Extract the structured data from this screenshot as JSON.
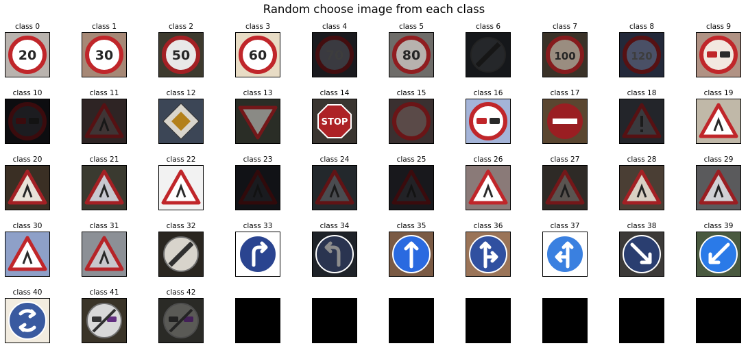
{
  "title": "Random choose image from each class",
  "classes": [
    {
      "label": "class 0",
      "icon": "speed-limit-20-sign-icon",
      "bg": "#b9b3ae",
      "shape": "circle-red",
      "fg": "#ffffff",
      "text": "20",
      "bright": 1.0
    },
    {
      "label": "class 1",
      "icon": "speed-limit-30-sign-icon",
      "bg": "#a68876",
      "shape": "circle-red",
      "fg": "#ffffff",
      "text": "30",
      "bright": 1.0
    },
    {
      "label": "class 2",
      "icon": "speed-limit-50-sign-icon",
      "bg": "#3d3a2e",
      "shape": "circle-red",
      "fg": "#e8e8e8",
      "text": "50",
      "bright": 0.85
    },
    {
      "label": "class 3",
      "icon": "speed-limit-60-sign-icon",
      "bg": "#e8dcc5",
      "shape": "circle-red",
      "fg": "#ffffff",
      "text": "60",
      "bright": 1.0
    },
    {
      "label": "class 4",
      "icon": "speed-limit-70-sign-icon",
      "bg": "#1a1a1e",
      "shape": "circle-red",
      "fg": "#3a3a40",
      "text": "70",
      "bright": 0.35
    },
    {
      "label": "class 5",
      "icon": "speed-limit-80-sign-icon",
      "bg": "#6e6c69",
      "shape": "circle-red",
      "fg": "#b7b2ae",
      "text": "80",
      "bright": 0.75
    },
    {
      "label": "class 6",
      "icon": "end-speed-limit-80-sign-icon",
      "bg": "#15171a",
      "shape": "circle-end",
      "fg": "#25272a",
      "text": "",
      "bright": 0.25
    },
    {
      "label": "class 7",
      "icon": "speed-limit-100-sign-icon",
      "bg": "#3a3228",
      "shape": "circle-red",
      "fg": "#9a8d80",
      "text": "100",
      "bright": 0.7
    },
    {
      "label": "class 8",
      "icon": "speed-limit-120-sign-icon",
      "bg": "#23293a",
      "shape": "circle-red",
      "fg": "#4a5066",
      "text": "120",
      "bright": 0.45
    },
    {
      "label": "class 9",
      "icon": "no-passing-sign-icon",
      "bg": "#b09284",
      "shape": "circle-nopass",
      "fg": "#f2e8e0",
      "text": "",
      "bright": 1.0
    },
    {
      "label": "class 10",
      "icon": "no-passing-trucks-sign-icon",
      "bg": "#0d0d10",
      "shape": "circle-nopass",
      "fg": "#1c1c20",
      "text": "",
      "bright": 0.3
    },
    {
      "label": "class 11",
      "icon": "right-of-way-sign-icon",
      "bg": "#2e2424",
      "shape": "triangle",
      "fg": "#3f3535",
      "text": "",
      "bright": 0.45
    },
    {
      "label": "class 12",
      "icon": "priority-road-sign-icon",
      "bg": "#3c4656",
      "shape": "diamond",
      "fg": "#d9d5cc",
      "text": "",
      "bright": 0.8
    },
    {
      "label": "class 13",
      "icon": "yield-sign-icon",
      "bg": "#2a2d26",
      "shape": "yield",
      "fg": "#8a8a85",
      "text": "",
      "bright": 0.6
    },
    {
      "label": "class 14",
      "icon": "stop-sign-icon",
      "bg": "#3a3530",
      "shape": "octagon",
      "fg": "#ffffff",
      "text": "STOP",
      "bright": 0.9
    },
    {
      "label": "class 15",
      "icon": "no-vehicles-sign-icon",
      "bg": "#3a3030",
      "shape": "circle-plain",
      "fg": "#5a4a48",
      "text": "",
      "bright": 0.55
    },
    {
      "label": "class 16",
      "icon": "no-trucks-sign-icon",
      "bg": "#a4b4d8",
      "shape": "circle-nopass",
      "fg": "#ffffff",
      "text": "",
      "bright": 1.0
    },
    {
      "label": "class 17",
      "icon": "no-entry-sign-icon",
      "bg": "#5a4630",
      "shape": "noentry",
      "fg": "#ffffff",
      "text": "",
      "bright": 0.8
    },
    {
      "label": "class 18",
      "icon": "general-caution-sign-icon",
      "bg": "#23252a",
      "shape": "triangle-excl",
      "fg": "#3a3a3e",
      "text": "",
      "bright": 0.45
    },
    {
      "label": "class 19",
      "icon": "dangerous-curve-left-sign-icon",
      "bg": "#c0b8a8",
      "shape": "triangle",
      "fg": "#ffffff",
      "text": "",
      "bright": 1.0
    },
    {
      "label": "class 20",
      "icon": "dangerous-curve-right-sign-icon",
      "bg": "#3a2f24",
      "shape": "triangle",
      "fg": "#e8e2d8",
      "text": "",
      "bright": 0.85
    },
    {
      "label": "class 21",
      "icon": "double-curve-sign-icon",
      "bg": "#3a3a30",
      "shape": "triangle",
      "fg": "#c8c8d0",
      "text": "",
      "bright": 0.85
    },
    {
      "label": "class 22",
      "icon": "bumpy-road-sign-icon",
      "bg": "#f2f2f2",
      "shape": "triangle",
      "fg": "#ffffff",
      "text": "",
      "bright": 1.0
    },
    {
      "label": "class 23",
      "icon": "slippery-road-sign-icon",
      "bg": "#111216",
      "shape": "triangle",
      "fg": "#1a1b1f",
      "text": "",
      "bright": 0.25
    },
    {
      "label": "class 24",
      "icon": "road-narrows-sign-icon",
      "bg": "#23282c",
      "shape": "triangle",
      "fg": "#4a4c50",
      "text": "",
      "bright": 0.5
    },
    {
      "label": "class 25",
      "icon": "road-work-sign-icon",
      "bg": "#18181c",
      "shape": "triangle",
      "fg": "#222226",
      "text": "",
      "bright": 0.3
    },
    {
      "label": "class 26",
      "icon": "traffic-signals-sign-icon",
      "bg": "#8a7a78",
      "shape": "triangle",
      "fg": "#ffffff",
      "text": "",
      "bright": 1.0
    },
    {
      "label": "class 27",
      "icon": "pedestrians-sign-icon",
      "bg": "#2e2a26",
      "shape": "triangle",
      "fg": "#5a5450",
      "text": "",
      "bright": 0.6
    },
    {
      "label": "class 28",
      "icon": "children-crossing-sign-icon",
      "bg": "#4a3e34",
      "shape": "triangle",
      "fg": "#d8d0c4",
      "text": "",
      "bright": 0.85
    },
    {
      "label": "class 29",
      "icon": "bicycles-crossing-sign-icon",
      "bg": "#5a5a5c",
      "shape": "triangle",
      "fg": "#d0d0d4",
      "text": "",
      "bright": 0.8
    },
    {
      "label": "class 30",
      "icon": "beware-ice-snow-sign-icon",
      "bg": "#8ea0c8",
      "shape": "triangle",
      "fg": "#ffffff",
      "text": "",
      "bright": 1.0
    },
    {
      "label": "class 31",
      "icon": "wild-animals-crossing-sign-icon",
      "bg": "#8c9096",
      "shape": "triangle",
      "fg": "#c8c8cc",
      "text": "",
      "bright": 0.95
    },
    {
      "label": "class 32",
      "icon": "end-of-all-limits-sign-icon",
      "bg": "#2a2620",
      "shape": "circle-end",
      "fg": "#d8d4cc",
      "text": "",
      "bright": 0.8
    },
    {
      "label": "class 33",
      "icon": "turn-right-ahead-sign-icon",
      "bg": "#ffffff",
      "shape": "blue-right",
      "fg": "#2a4490",
      "text": "",
      "bright": 1.0
    },
    {
      "label": "class 34",
      "icon": "turn-left-ahead-sign-icon",
      "bg": "#1e2228",
      "shape": "blue-left",
      "fg": "#2a3450",
      "text": "",
      "bright": 0.45
    },
    {
      "label": "class 35",
      "icon": "ahead-only-sign-icon",
      "bg": "#7a5a44",
      "shape": "blue-up",
      "fg": "#2a6ae0",
      "text": "",
      "bright": 1.0
    },
    {
      "label": "class 36",
      "icon": "go-straight-or-right-sign-icon",
      "bg": "#9a7458",
      "shape": "blue-up-right",
      "fg": "#3050a0",
      "text": "",
      "bright": 0.95
    },
    {
      "label": "class 37",
      "icon": "go-straight-or-left-sign-icon",
      "bg": "#ffffff",
      "shape": "blue-up-left",
      "fg": "#3a80e0",
      "text": "",
      "bright": 1.0
    },
    {
      "label": "class 38",
      "icon": "keep-right-sign-icon",
      "bg": "#3c3a38",
      "shape": "blue-down-right",
      "fg": "#2a3e70",
      "text": "",
      "bright": 0.7
    },
    {
      "label": "class 39",
      "icon": "keep-left-sign-icon",
      "bg": "#4a5a40",
      "shape": "blue-down-left",
      "fg": "#2a7ae8",
      "text": "",
      "bright": 1.0
    },
    {
      "label": "class 40",
      "icon": "roundabout-mandatory-sign-icon",
      "bg": "#f2ece0",
      "shape": "blue-round",
      "fg": "#3a5aa0",
      "text": "",
      "bright": 1.0
    },
    {
      "label": "class 41",
      "icon": "end-of-no-passing-sign-icon",
      "bg": "#3a3428",
      "shape": "circle-endpass",
      "fg": "#d8d8d8",
      "text": "",
      "bright": 0.8
    },
    {
      "label": "class 42",
      "icon": "end-no-passing-trucks-sign-icon",
      "bg": "#2a2a26",
      "shape": "circle-endpass",
      "fg": "#5a5a56",
      "text": "",
      "bright": 0.55
    },
    {
      "label": "",
      "icon": "empty-black-tile",
      "bg": "#000000",
      "shape": "none",
      "fg": "#000000",
      "text": "",
      "bright": 0
    },
    {
      "label": "",
      "icon": "empty-black-tile",
      "bg": "#000000",
      "shape": "none",
      "fg": "#000000",
      "text": "",
      "bright": 0
    },
    {
      "label": "",
      "icon": "empty-black-tile",
      "bg": "#000000",
      "shape": "none",
      "fg": "#000000",
      "text": "",
      "bright": 0
    },
    {
      "label": "",
      "icon": "empty-black-tile",
      "bg": "#000000",
      "shape": "none",
      "fg": "#000000",
      "text": "",
      "bright": 0
    },
    {
      "label": "",
      "icon": "empty-black-tile",
      "bg": "#000000",
      "shape": "none",
      "fg": "#000000",
      "text": "",
      "bright": 0
    },
    {
      "label": "",
      "icon": "empty-black-tile",
      "bg": "#000000",
      "shape": "none",
      "fg": "#000000",
      "text": "",
      "bright": 0
    },
    {
      "label": "",
      "icon": "empty-black-tile",
      "bg": "#000000",
      "shape": "none",
      "fg": "#000000",
      "text": "",
      "bright": 0
    }
  ]
}
